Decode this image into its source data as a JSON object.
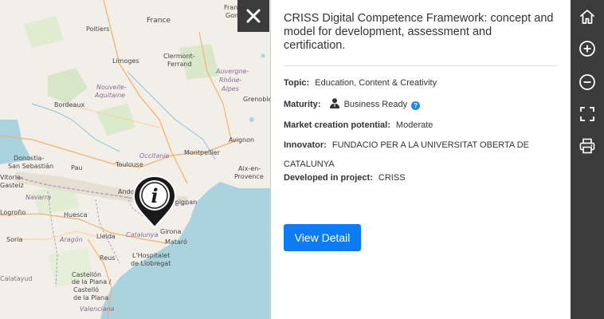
{
  "map": {
    "places": [
      {
        "name": "Poitiers",
        "kind": "city"
      },
      {
        "name": "France",
        "kind": "country"
      },
      {
        "name": "Limoges",
        "kind": "city"
      },
      {
        "name": "Clermont-",
        "kind": "city"
      },
      {
        "name": "Ferrand",
        "kind": "city"
      },
      {
        "name": "Nouvelle-",
        "kind": "region"
      },
      {
        "name": "Aquitaine",
        "kind": "region"
      },
      {
        "name": "Auvergne-",
        "kind": "region"
      },
      {
        "name": "Rhône-",
        "kind": "region"
      },
      {
        "name": "Alpes",
        "kind": "region"
      },
      {
        "name": "Grenoble",
        "kind": "city"
      },
      {
        "name": "Bordeaux",
        "kind": "city"
      },
      {
        "name": "Avignon",
        "kind": "city"
      },
      {
        "name": "Occitanie",
        "kind": "region"
      },
      {
        "name": "Montpellier",
        "kind": "city"
      },
      {
        "name": "Donostia-",
        "kind": "city"
      },
      {
        "name": "San Sebastián",
        "kind": "city"
      },
      {
        "name": "Vitoria-",
        "kind": "city"
      },
      {
        "name": "Gasteiz",
        "kind": "city"
      },
      {
        "name": "Pau",
        "kind": "city"
      },
      {
        "name": "Toulouse",
        "kind": "city"
      },
      {
        "name": "Aix-en-",
        "kind": "city"
      },
      {
        "name": "Provence",
        "kind": "city"
      },
      {
        "name": "Navarra",
        "kind": "region"
      },
      {
        "name": "Andorra",
        "kind": "country"
      },
      {
        "name": "Logroño",
        "kind": "city"
      },
      {
        "name": "Huesca",
        "kind": "city"
      },
      {
        "name": "Girona",
        "kind": "city"
      },
      {
        "name": "Aragón",
        "kind": "region"
      },
      {
        "name": "Lleida",
        "kind": "city"
      },
      {
        "name": "Catalunya",
        "kind": "region"
      },
      {
        "name": "Mataró",
        "kind": "city"
      },
      {
        "name": "Soria",
        "kind": "city"
      },
      {
        "name": "Reus",
        "kind": "city"
      },
      {
        "name": "L'Hospitalet",
        "kind": "city"
      },
      {
        "name": "de Llobregat",
        "kind": "city"
      },
      {
        "name": "Castellón",
        "kind": "city"
      },
      {
        "name": "de la Plana /",
        "kind": "city"
      },
      {
        "name": "Castelló",
        "kind": "city"
      },
      {
        "name": "de la Plana",
        "kind": "city"
      },
      {
        "name": "Valenciana",
        "kind": "region"
      },
      {
        "name": "Franc",
        "kind": "city"
      },
      {
        "name": "Gom",
        "kind": "city"
      },
      {
        "name": "Perpignan",
        "kind": "city"
      },
      {
        "name": "Calatayud",
        "kind": "city"
      }
    ]
  },
  "close_button": {
    "icon": "close-icon"
  },
  "panel": {
    "title": "CRISS Digital Competence Framework: concept and model for development, assessment and certification.",
    "topic_label": "Topic:",
    "topic_value": "Education, Content & Creativity",
    "maturity_label": "Maturity:",
    "maturity_value": "Business Ready",
    "maturity_help": "?",
    "market_label": "Market creation potential:",
    "market_value": "Moderate",
    "innovator_label": "Innovator:",
    "innovator_value": "FUNDACIO PER A LA UNIVERSITAT OBERTA DE CATALUNYA",
    "project_label": "Developed in project:",
    "project_value": "CRISS",
    "view_detail_label": "View Detail"
  },
  "toolbar": {
    "items": [
      {
        "icon": "home-icon"
      },
      {
        "icon": "zoom-in-icon"
      },
      {
        "icon": "zoom-out-icon"
      },
      {
        "icon": "fullscreen-icon"
      },
      {
        "icon": "print-icon"
      }
    ]
  },
  "colors": {
    "sea": "#aad3df",
    "land": "#f2efe9",
    "toolbar": "#3b3b3b",
    "button": "#0d7cf2"
  }
}
